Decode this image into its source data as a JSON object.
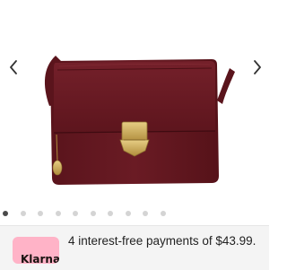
{
  "product": {
    "image_alt": "Burgundy leather crossbody bag with gold push-lock clasp",
    "colors": {
      "leather": "#6b1a22",
      "hardware": "#c9a64a"
    }
  },
  "carousel": {
    "prev_icon": "chevron-left-icon",
    "next_icon": "chevron-right-icon",
    "slide_count": 10,
    "active_index": 0
  },
  "payment": {
    "provider_badge": "Klarna",
    "text": "4 interest-free payments of $43.99.",
    "badge_color": "#ffb3c7"
  }
}
